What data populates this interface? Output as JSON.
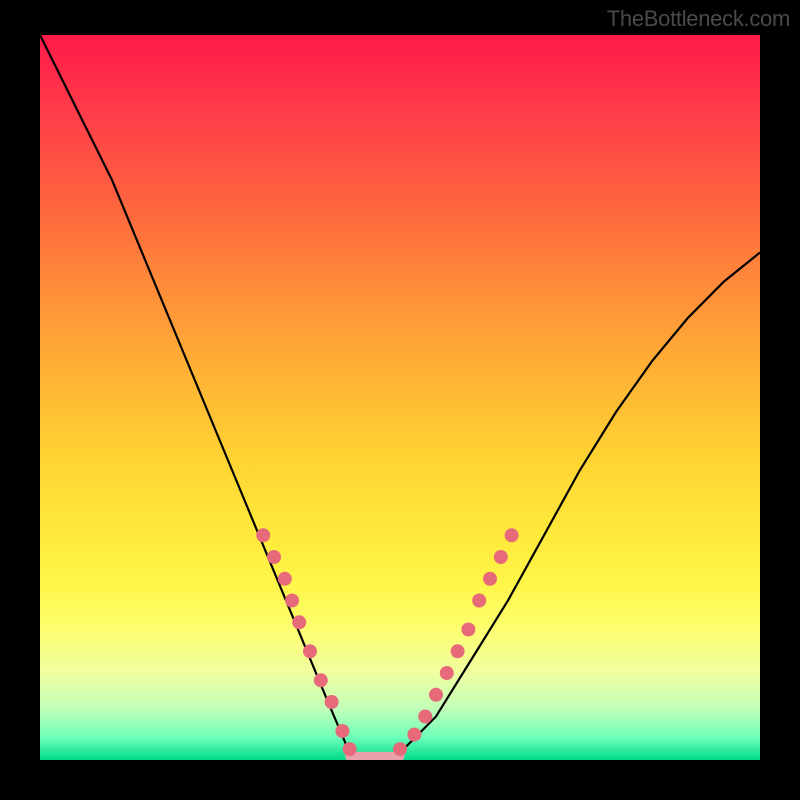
{
  "watermark": "TheBottleneck.com",
  "chart_data": {
    "type": "line",
    "title": "",
    "xlabel": "",
    "ylabel": "",
    "xlim": [
      0,
      100
    ],
    "ylim": [
      0,
      100
    ],
    "background_gradient": {
      "top": "#ff1a4a",
      "bottom": "#00d98a"
    },
    "curve": {
      "description": "V-shaped bottleneck curve",
      "x": [
        0,
        5,
        10,
        15,
        20,
        25,
        30,
        35,
        40,
        43,
        47,
        50,
        55,
        60,
        65,
        70,
        75,
        80,
        85,
        90,
        95,
        100
      ],
      "y": [
        100,
        90,
        80,
        68,
        56,
        44,
        32,
        20,
        8,
        1,
        0,
        1,
        6,
        14,
        22,
        31,
        40,
        48,
        55,
        61,
        66,
        70
      ]
    },
    "markers_left": {
      "description": "pink dots on left arm of V",
      "x": [
        31,
        32.5,
        34,
        35,
        36,
        37.5,
        39,
        40.5,
        42,
        43
      ],
      "y": [
        31,
        28,
        25,
        22,
        19,
        15,
        11,
        8,
        4,
        1.5
      ]
    },
    "markers_right": {
      "description": "pink dots on right arm of V",
      "x": [
        50,
        52,
        53.5,
        55,
        56.5,
        58,
        59.5,
        61,
        62.5,
        64,
        65.5
      ],
      "y": [
        1.5,
        3.5,
        6,
        9,
        12,
        15,
        18,
        22,
        25,
        28,
        31
      ]
    },
    "flat_bottom": {
      "description": "light pink flat segment at curve minimum",
      "x_start": 43,
      "x_end": 50,
      "y": 0.5
    },
    "colors": {
      "curve": "#000000",
      "markers": "#e66a7a",
      "flat": "#e9a0aa"
    }
  }
}
